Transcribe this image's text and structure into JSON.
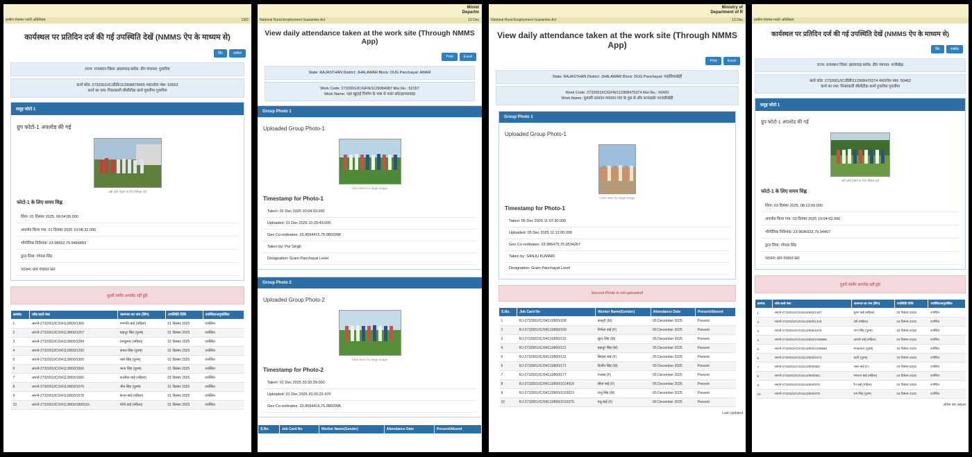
{
  "p1": {
    "act_label": "ग्रामीण रोजगार गारंटी अधिनियम",
    "act_right": "13/D",
    "title": "कार्यस्थल पर प्रतिदिन दर्ज की गई उपस्थिति देखें (NMMS ऐप के माध्यम से)",
    "btn_print": "प्रिंट",
    "btn_excel": "एक्सेल",
    "info1": "राज्य: राजस्थान जिला: झालावाड़ ब्लॉक: डीग पंचायत: गुवारीया",
    "info2a": "कार्य कोड: 2732001/IC/डीडी/112908879665 मस्टररोल नंबर: 53563",
    "info2b": "कार्य का नाम: नियतकारी सीसीटीडा कार्य गुवारीया गुवारीया",
    "card_head": "समूह फोटो 1",
    "sub": "ग्रुप फोटो-1 अपलोड की गई",
    "caption": "बड़ी छवि देखने के लिए क्लिक करें",
    "ts_head": "फोटो-1 के लिए समय चिह्न",
    "ts1": "लिया: 01 दिसंबर 2025, 09:04:05.000",
    "ts2": "अपलोड किया गया: 01 दिसंबर 2025 10:08:32.000",
    "ts3": "भौगोलिक निर्देशांक: 23.98552,75.9466883",
    "ts4": "द्वारा लिया: गोपाल सिंह",
    "ts5": "पदनाम: ग्राम पंचायत स्तर",
    "alert": "दूसरी तस्वीर अपलोड नहीं हुई!",
    "headers": [
      "क्रमांक",
      "जॉब कार्ड नंबर",
      "कामगार का नाम (लिंग)",
      "उपस्थिति तिथि",
      "उपस्थित/अनुपस्थित"
    ],
    "rows": [
      [
        "1",
        "आरजे-2732001/IC/04113/800/1366",
        "गणपति बाई (महिला)",
        "01 दिसंबर 2025",
        "उपस्थित"
      ],
      [
        "2",
        "आरजे-2732001/IC/04113/800/1257",
        "बहादुर सिंह (पुरुष)",
        "01 दिसंबर 2025",
        "उपस्थित"
      ],
      [
        "3",
        "आरजे-2732001/IC/04113/800/1284",
        "रामकुमार (महिला)",
        "01 दिसंबर 2025",
        "उपस्थित"
      ],
      [
        "4",
        "आरजे-2732001/IC/04113/800/1290",
        "कमल सिंह (पुरुष)",
        "01 दिसंबर 2025",
        "उपस्थित"
      ],
      [
        "5",
        "आरजे-2732001/IC/04113/800/1300",
        "प्यारे सिंह (पुरुष)",
        "01 दिसंबर 2025",
        "उपस्थित"
      ],
      [
        "6",
        "आरजे-2732001/IC/04113/800/1566",
        "भाना सिंह (पुरुष)",
        "01 दिसंबर 2025",
        "उपस्थित"
      ],
      [
        "7",
        "आरजे-2732001/IC/04113/800/1666",
        "कालीया बाई (महिला)",
        "01 दिसंबर 2025",
        "उपस्थित"
      ],
      [
        "8",
        "आरजे-2732001/IC/04113/800/1676",
        "जीत सिंह (पुरुष)",
        "01 दिसंबर 2025",
        "उपस्थित"
      ],
      [
        "9",
        "आरजे-2732001/IC/04113/800/1678",
        "केशर बाई (महिला)",
        "01 दिसंबर 2025",
        "उपस्थित"
      ],
      [
        "10",
        "आरजे-2732001/IC/04113/800/1808116",
        "मोती बाई (महिला)",
        "01 दिसंबर 2025",
        "उपस्थित"
      ]
    ]
  },
  "p2": {
    "ministry1": "Minist",
    "ministry2": "Departm",
    "act_label": "National Rural Employment Guarantee Act",
    "act_right": "13 Dec",
    "title": "View daily attendance taken at the work site (Through NMMS App)",
    "btn_print": "Print",
    "btn_excel": "Excel",
    "info1": "State: RAJASTHAN District: JHALAWAR Block: DUG Panchayat: AWAR",
    "info2a": "Work Code: 2732001/IC/GFN/1129084087 Msr.No.: 52157",
    "info2b": "Work Name: नहर खुदाई निर्माण के पास से नाला कोटड़ा/फरवाड़ा",
    "card1_head": "Group Photo 1",
    "sub1": "Uploaded Group Photo-1",
    "caption1": "Click here for large image",
    "ts1_head": "Timestamp for Photo-1",
    "ts1_1": "Taken: 01 Dec 2025 10:04:03.000",
    "ts1_2": "Uploaded: 01 Dec 2025 10:20:43.000",
    "ts1_3": "Geo Co-ordinates: 23.9594415,75.9802996",
    "ts1_4": "Taken by: Pur Singh",
    "ts1_5": "Designation: Gram Panchayat Level",
    "card2_head": "Group Photo 2",
    "sub2": "Uploaded Group Photo-2",
    "caption2": "Click here for large image",
    "ts2_head": "Timestamp for Photo-2",
    "ts2_1": "Taken: 01 Dec 2025 20:33:39.000",
    "ts2_2": "Uploaded: 01 Dec 2025 20:20:23.470",
    "ts2_3": "Geo Co-ordinates: 23.9594415,75.9802996",
    "headers": [
      "S.No.",
      "Job Card No",
      "Worker Name(Gender)",
      "Attendance Date",
      "Present/Absent"
    ]
  },
  "p3": {
    "ministry1": "Ministry of",
    "ministry2": "Department of R",
    "act_label": "National Rural Employment Guarantee Act",
    "act_right": "13 Dec",
    "title": "View daily attendance taken at the work site (Through NMMS App)",
    "btn_print": "Print",
    "btn_excel": "Excel",
    "info1": "State: RAJASTHAN District: JHALAWAR Block: DUG Panchayat: पाड़लियाखेड़ी",
    "info2a": "Work Code: 2732001/IC/GFN/112908479374 Msr.No.: 50420",
    "info2b": "Work Name: पुलाली उत्पादन मगावान गांव के पुल से और कन्याइसे/ पटवारीखेड़ी",
    "card_head": "Group Photo 1",
    "sub": "Uploaded Group Photo-1",
    "caption": "Click here for large image",
    "ts_head": "Timestamp for Photo-1",
    "ts1": "Taken: 05 Dec 2025 11:07:30.000",
    "ts2": "Uploaded: 05 Dec 2025 11:12:00.000",
    "ts3": "Geo Co-ordinates: 23.986475,75.9534267",
    "ts4": "Taken by: SANJU KUMARI",
    "ts5": "Designation: Gram Panchayat Level",
    "alert": "Second Photo is not uploaded!",
    "headers": [
      "S.No.",
      "Job Card No",
      "Worker Name(Gender)",
      "Attendance Date",
      "Present/Absent"
    ],
    "rows": [
      [
        "1",
        "RJ-2732001/IC/04113/800/108",
        "कस्तूरी (M)",
        "05 December 2025",
        "Present"
      ],
      [
        "2",
        "RJ-2732001/IC/04113/800/109",
        "निर्मला बाई (F)",
        "05 December 2025",
        "Present"
      ],
      [
        "3",
        "RJ-2732001/IC/04113/800/110",
        "सुंदर सिंह (M)",
        "05 December 2025",
        "Present"
      ],
      [
        "4",
        "RJ-2732001/IC/04113/800/121",
        "बहादुर सिंह (M)",
        "05 December 2025",
        "Present"
      ],
      [
        "5",
        "RJ-2732001/IC/04113/800/131",
        "सिदास बाई (F)",
        "05 December 2025",
        "Present"
      ],
      [
        "6",
        "RJ-2732001/IC/04113/800/171",
        "दिलीप सिंह (M)",
        "05 December 2025",
        "Present"
      ],
      [
        "7",
        "RJ-2732001/IC/04113/800/177",
        "गलाबा (F)",
        "05 December 2025",
        "Present"
      ],
      [
        "8",
        "RJ-2732001/IC/04113/800/1014918",
        "सीता बाई (F)",
        "05 December 2025",
        "Present"
      ],
      [
        "9",
        "RJ-2732001/IC/04113/800/1015023",
        "राजू सिंह (M)",
        "05 December 2025",
        "Present"
      ],
      [
        "10",
        "RJ-2732001/IC/04113/800/1016375",
        "मधु बाई (F)",
        "05 December 2025",
        "Present"
      ]
    ],
    "lastupd": "Last Updated"
  },
  "p4": {
    "act_label": "ग्रामीण रोजगार गारंटी अधिनियम",
    "title": "कार्यस्थल पर प्रतिदिन दर्ज की गई उपस्थिति देखें (NMMS ऐप के माध्यम से)",
    "btn_print": "प्रिंट",
    "btn_excel": "एक्सेल",
    "info1": "राज्य: राजस्थान जिला: झालावाड़ ब्लॉक: डीग पंचायत: पानीखेड़ा",
    "info2a": "कार्य कोड: 2732001/IC/डीडी/112908479374 मस्टररोल नंबर: 50462",
    "info2b": "कार्य का नाम: नियतकारी सीसीटीडा कार्य गुवारीया गुवारीया",
    "card_head": "समूह फोटो 1",
    "sub": "ग्रुप फोटो-1 अपलोड की गई",
    "caption": "बड़ी छवि देखने के लिए क्लिक करें",
    "ts_head": "फोटो-1 के लिए समय चिह्न",
    "ts1": "लिया: 03 दिसंबर 2025, 08:12:00.000",
    "ts2": "अपलोड किया गया: 03 दिसंबर 2025 10:04:03.000",
    "ts3": "भौगोलिक निर्देशांक: 23.9696933,75.94467",
    "ts4": "द्वारा लिया: गोपाल सिंह",
    "ts5": "पदनाम: ग्राम पंचायत स्तर",
    "alert": "दूसरी तस्वीर अपलोड नहीं हुई!",
    "headers": [
      "क्रमांक",
      "जॉब कार्ड नंबर",
      "कामगार का नाम (लिंग)",
      "उपस्थिति तिथि",
      "उपस्थित/अनुपस्थित"
    ],
    "rows": [
      [
        "1",
        "आरजे-2732001/IC/04113/800/1337",
        "सुगन बाई (महिला)",
        "03 दिसंबर 2025",
        "उपस्थित"
      ],
      [
        "2",
        "आरजे-2732001/IC/04113/800/1343",
        "देवी (महिला)",
        "03 दिसंबर 2025",
        "उपस्थित"
      ],
      [
        "3",
        "आरजे-2732001/IC/04113/800/1670",
        "नाना सिंह (पुरुष)",
        "03 दिसंबर 2025",
        "उपस्थित"
      ],
      [
        "4",
        "आरजे-2732001/IC/04113/800/1039966",
        "कमली बाई (महिला)",
        "03 दिसंबर 2025",
        "उपस्थित"
      ],
      [
        "5",
        "आरजे-2732001/IC/04113/800/1039968",
        "मनकलाल (पुरुष)",
        "03 दिसंबर 2025",
        "उपस्थित"
      ],
      [
        "6",
        "आरजे-2732001/IC/04113/800/1074",
        "बदरी (पुरुष)",
        "03 दिसंबर 2025",
        "उपस्थित"
      ],
      [
        "7",
        "आरजे-2732001/IC/04113/800/882",
        "अमर बाई (F)",
        "03 दिसंबर 2025",
        "उपस्थित"
      ],
      [
        "8",
        "आरजे-2732001/IC/04113/800/883",
        "भगवान बाई (महिला)",
        "03 दिसंबर 2025",
        "उपस्थित"
      ],
      [
        "9",
        "आरजे-2732001/IC/04113/800/876",
        "रैन बाई (महिला)",
        "03 दिसंबर 2025",
        "उपस्थित"
      ],
      [
        "10",
        "आरजे-2732001/IC/04113/800/879",
        "राम सिंह (पुरुष)",
        "03 दिसंबर 2025",
        "उपस्थित"
      ]
    ],
    "lastupd": "अंतिम बार अद्यतन"
  }
}
